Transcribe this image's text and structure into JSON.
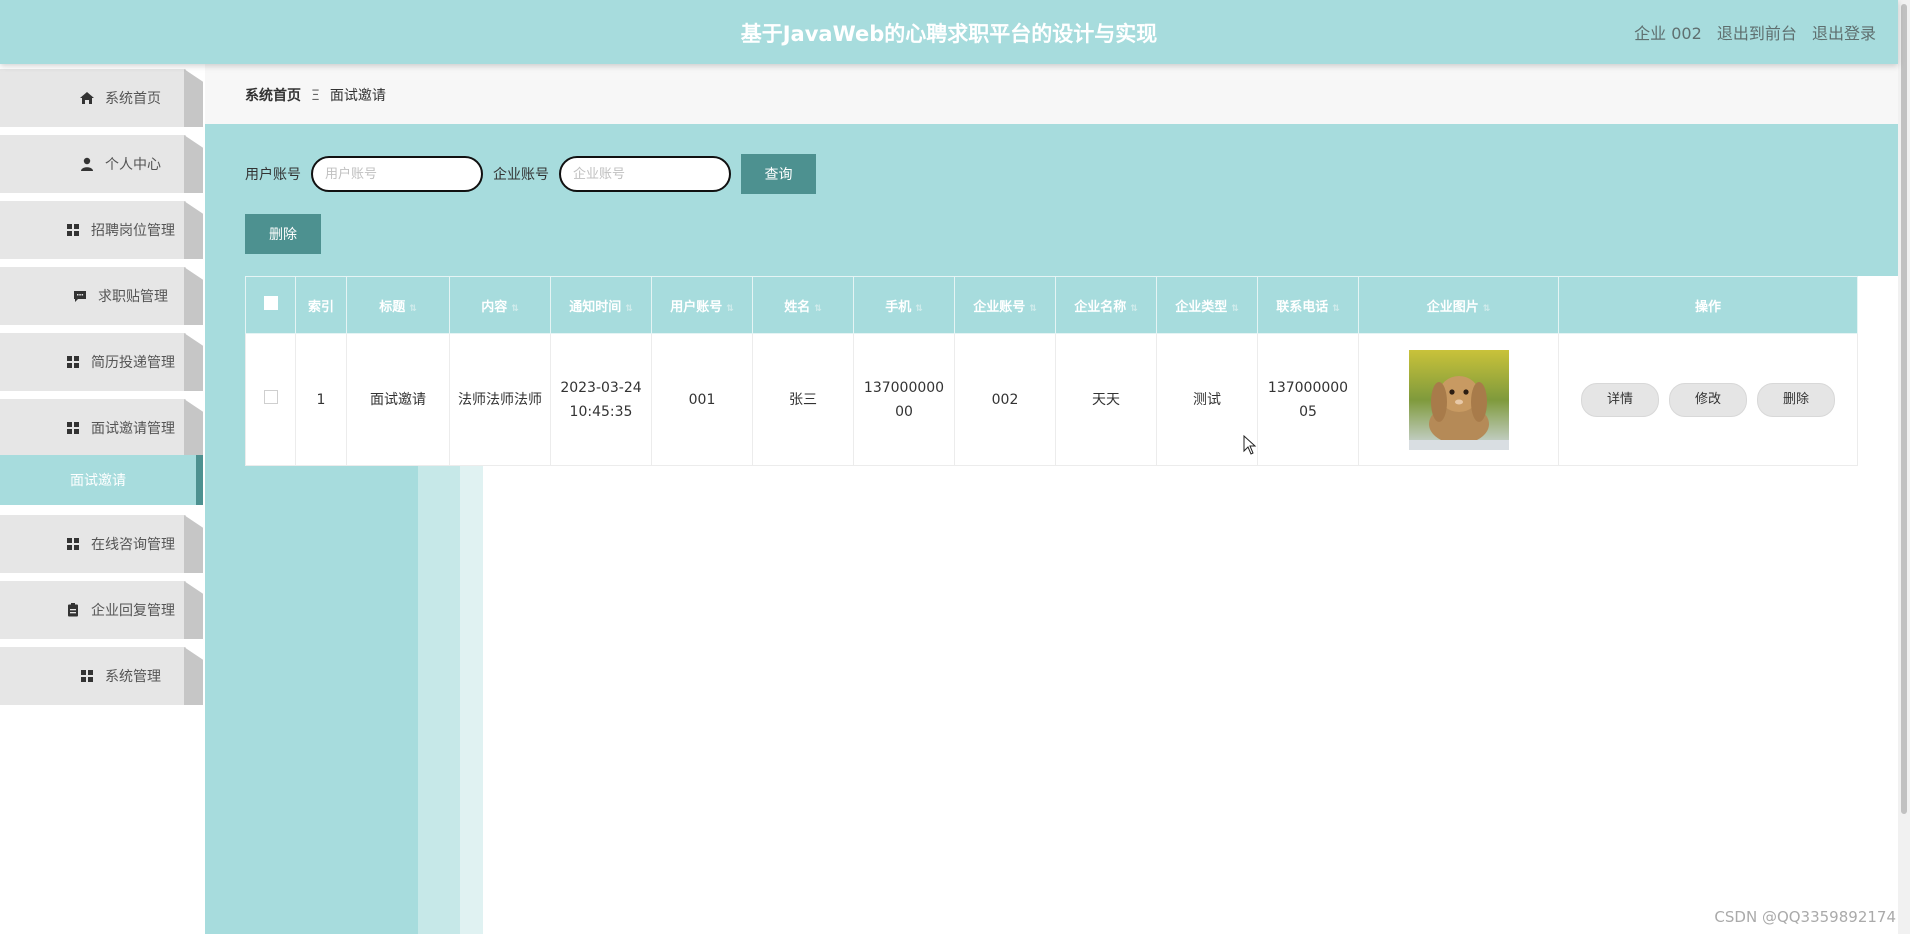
{
  "header": {
    "title": "基于JavaWeb的心聘求职平台的设计与实现",
    "user_label": "企业 002",
    "front_link": "退出到前台",
    "logout_link": "退出登录"
  },
  "sidebar": {
    "items": [
      {
        "label": "系统首页",
        "icon": "home-icon"
      },
      {
        "label": "个人中心",
        "icon": "person-icon"
      },
      {
        "label": "招聘岗位管理",
        "icon": "grid-icon"
      },
      {
        "label": "求职贴管理",
        "icon": "chat-icon"
      },
      {
        "label": "简历投递管理",
        "icon": "grid-icon"
      },
      {
        "label": "面试邀请管理",
        "icon": "grid-icon"
      },
      {
        "label": "在线咨询管理",
        "icon": "grid-icon"
      },
      {
        "label": "企业回复管理",
        "icon": "clipboard-icon"
      },
      {
        "label": "系统管理",
        "icon": "grid-icon"
      }
    ],
    "active_sub": "面试邀请"
  },
  "breadcrumb": {
    "home": "系统首页",
    "separator": "Ξ",
    "current": "面试邀请"
  },
  "search": {
    "user_label": "用户账号",
    "user_placeholder": "用户账号",
    "company_label": "企业账号",
    "company_placeholder": "企业账号",
    "query_button": "查询",
    "delete_button": "删除"
  },
  "table": {
    "columns": [
      "索引",
      "标题",
      "内容",
      "通知时间",
      "用户账号",
      "姓名",
      "手机",
      "企业账号",
      "企业名称",
      "企业类型",
      "联系电话",
      "企业图片",
      "操作"
    ],
    "rows": [
      {
        "index": "1",
        "title": "面试邀请",
        "content": "法师法师法师",
        "time": "2023-03-24 10:45:35",
        "user_account": "001",
        "name": "张三",
        "phone": "13700000000",
        "company_account": "002",
        "company_name": "天天",
        "company_type": "测试",
        "contact_phone": "13700000005",
        "image": "rabbit-photo"
      }
    ],
    "actions": {
      "detail": "详情",
      "edit": "修改",
      "delete": "删除"
    }
  },
  "watermark": "CSDN @QQ3359892174",
  "colors": {
    "accent": "#a7dcdd",
    "button": "#4d9190",
    "sidebar_item": "#e6e6e6"
  }
}
